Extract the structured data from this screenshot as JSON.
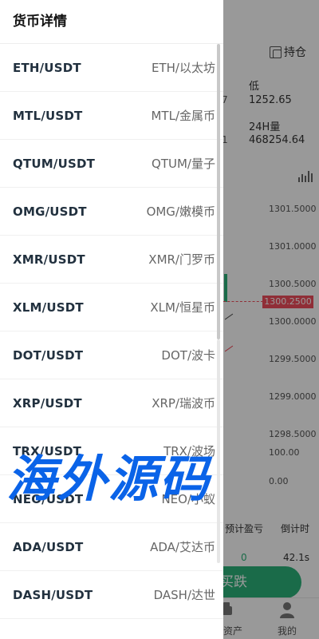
{
  "background": {
    "hold_label": "持仓",
    "stat_frag_1": "7",
    "stat_low_label": "低",
    "stat_low_value": "1252.65",
    "stat_frag_2": "1",
    "stat_vol_label": "24H量",
    "stat_vol_value": "468254.64",
    "price_levels": [
      "1301.5000",
      "1301.0000",
      "1300.5000",
      "1300.0000",
      "1299.5000",
      "1299.0000",
      "1298.5000"
    ],
    "current_price": "1300.2500",
    "volume_levels": [
      "100.00",
      "0.00"
    ],
    "table_headers": [
      "预计盈亏",
      "倒计时"
    ],
    "table_row": [
      "0",
      "42.1s"
    ],
    "sell_button": "买跌",
    "tab_asset_label": "资产",
    "tab_mine_label": "我的",
    "colors": {
      "up": "#2cb37a",
      "down": "#f14e5c"
    }
  },
  "drawer": {
    "title": "货币详情",
    "items": [
      {
        "pair": "ETH/USDT",
        "name": "ETH/以太坊"
      },
      {
        "pair": "MTL/USDT",
        "name": "MTL/金属币"
      },
      {
        "pair": "QTUM/USDT",
        "name": "QTUM/量子"
      },
      {
        "pair": "OMG/USDT",
        "name": "OMG/嫩模币"
      },
      {
        "pair": "XMR/USDT",
        "name": "XMR/门罗币"
      },
      {
        "pair": "XLM/USDT",
        "name": "XLM/恒星币"
      },
      {
        "pair": "DOT/USDT",
        "name": "DOT/波卡"
      },
      {
        "pair": "XRP/USDT",
        "name": "XRP/瑞波币"
      },
      {
        "pair": "TRX/USDT",
        "name": "TRX/波场"
      },
      {
        "pair": "NEO/USDT",
        "name": "NEO/小蚁"
      },
      {
        "pair": "ADA/USDT",
        "name": "ADA/艾达币"
      },
      {
        "pair": "DASH/USDT",
        "name": "DASH/达世"
      }
    ]
  },
  "watermark": {
    "text": "海外源码"
  }
}
